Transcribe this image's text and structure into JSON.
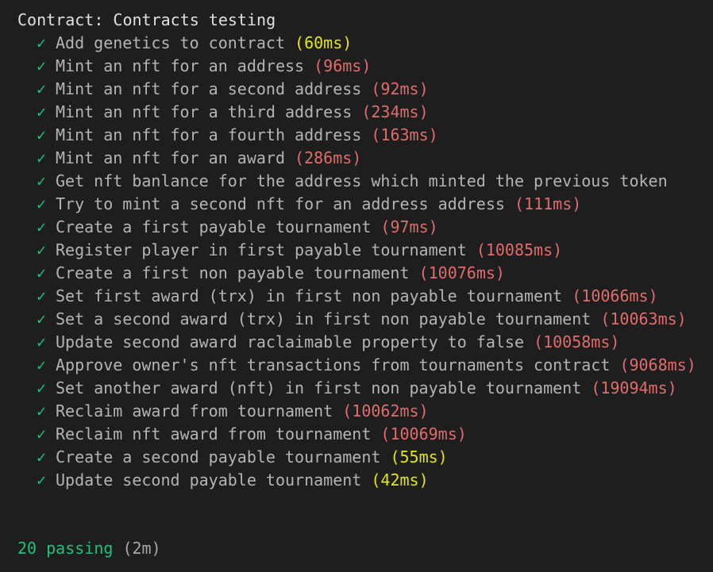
{
  "suite_title": "Contract: Contracts testing",
  "check_glyph": "✓",
  "tests": [
    {
      "title": "Add genetics to contract",
      "duration": "(60ms)",
      "speed": "medium"
    },
    {
      "title": "Mint an nft for an address",
      "duration": "(96ms)",
      "speed": "slow"
    },
    {
      "title": "Mint an nft for a second address",
      "duration": "(92ms)",
      "speed": "slow"
    },
    {
      "title": "Mint an nft for a third address",
      "duration": "(234ms)",
      "speed": "slow"
    },
    {
      "title": "Mint an nft for a fourth address",
      "duration": "(163ms)",
      "speed": "slow"
    },
    {
      "title": "Mint an nft for an award",
      "duration": "(286ms)",
      "speed": "slow"
    },
    {
      "title": "Get nft banlance for the address which minted the previous token",
      "duration": "",
      "speed": "fast"
    },
    {
      "title": "Try to mint a second nft for an address address",
      "duration": "(111ms)",
      "speed": "slow"
    },
    {
      "title": "Create a first payable tournament",
      "duration": "(97ms)",
      "speed": "slow"
    },
    {
      "title": "Register player in first payable tournament",
      "duration": "(10085ms)",
      "speed": "slow"
    },
    {
      "title": "Create a first non payable tournament",
      "duration": "(10076ms)",
      "speed": "slow"
    },
    {
      "title": "Set first award (trx) in first non payable tournament",
      "duration": "(10066ms)",
      "speed": "slow"
    },
    {
      "title": "Set a second award (trx) in first non payable tournament",
      "duration": "(10063ms)",
      "speed": "slow"
    },
    {
      "title": "Update second award raclaimable property to false",
      "duration": "(10058ms)",
      "speed": "slow"
    },
    {
      "title": "Approve owner's nft transactions from tournaments contract",
      "duration": "(9068ms)",
      "speed": "slow"
    },
    {
      "title": "Set another award (nft) in first non payable tournament",
      "duration": "(19094ms)",
      "speed": "slow"
    },
    {
      "title": "Reclaim award from tournament",
      "duration": "(10062ms)",
      "speed": "slow"
    },
    {
      "title": "Reclaim nft award from tournament",
      "duration": "(10069ms)",
      "speed": "slow"
    },
    {
      "title": "Create a second payable tournament",
      "duration": "(55ms)",
      "speed": "medium"
    },
    {
      "title": "Update second payable tournament",
      "duration": "(42ms)",
      "speed": "medium"
    }
  ],
  "summary": {
    "passing": "20 passing",
    "time": "(2m)"
  },
  "colors": {
    "background": "#1e1e1e",
    "pass": "#22c07c",
    "slow": "#e06c6c",
    "medium": "#e5e510"
  }
}
